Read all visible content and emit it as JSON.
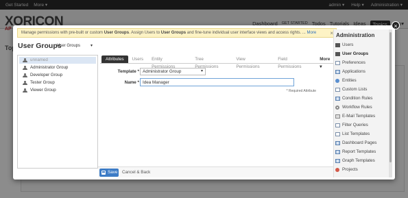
{
  "topbar": {
    "get_started": "Get Started",
    "more": "More ▾",
    "user": "admin ▾",
    "help": "Help ▾",
    "administration": "Administration ▾"
  },
  "app": {
    "logo": "XORICON",
    "logo_sub": "AP"
  },
  "mainnav": [
    "Dashboard",
    "GET STARTED",
    "Todos",
    "Tutorials",
    "Ideas",
    "Topics",
    "Mo▾"
  ],
  "background": {
    "title": "Top"
  },
  "notice": {
    "text_1": "Manage permissions with pre-built or custom ",
    "b1": "User Groups",
    "text_2": ". Assign Users to ",
    "b2": "User Groups",
    "text_3": " and fine-tune individual user interface views and access rights. ...",
    "more": "More",
    "close": "×"
  },
  "page": {
    "title": "User Groups",
    "group_select": "User Groups",
    "caret": "▾"
  },
  "groups": [
    {
      "label": "unnamed",
      "selected": true
    },
    {
      "label": "Administrator Group",
      "selected": false
    },
    {
      "label": "Developer Group",
      "selected": false
    },
    {
      "label": "Tester Group",
      "selected": false
    },
    {
      "label": "Viewer Group",
      "selected": false
    }
  ],
  "tabs": [
    "Attributes",
    "Users",
    "Entity Permissions",
    "Tree Permissions",
    "View Permissions",
    "Field Permissions",
    "More ▾"
  ],
  "form": {
    "template_label": "Template *",
    "template_value": "Administrator Group",
    "name_label": "Name *",
    "name_value": "Idea Manager",
    "required_note": "* Required Attribute"
  },
  "footer": {
    "save": "Save",
    "cancel": "Cancel & Back"
  },
  "admin_menu": {
    "title": "Administration",
    "items": [
      {
        "label": "Users",
        "icon": "users-icon"
      },
      {
        "label": "User Groups",
        "icon": "user-groups-icon",
        "active": true
      },
      {
        "label": "Preferences",
        "icon": "preferences-icon"
      },
      {
        "label": "Applications",
        "icon": "applications-icon"
      },
      {
        "label": "Entities",
        "icon": "entities-icon"
      },
      {
        "label": "Custom Lists",
        "icon": "custom-lists-icon"
      },
      {
        "label": "Condition Rules",
        "icon": "condition-rules-icon"
      },
      {
        "label": "Workflow Rules",
        "icon": "workflow-rules-icon"
      },
      {
        "label": "E-Mail Templates",
        "icon": "email-templates-icon"
      },
      {
        "label": "Filter Queries",
        "icon": "filter-queries-icon"
      },
      {
        "label": "List Templates",
        "icon": "list-templates-icon"
      },
      {
        "label": "Dashboard Pages",
        "icon": "dashboard-pages-icon"
      },
      {
        "label": "Report Templates",
        "icon": "report-templates-icon"
      },
      {
        "label": "Graph Templates",
        "icon": "graph-templates-icon"
      },
      {
        "label": "Projects",
        "icon": "projects-icon"
      }
    ]
  },
  "modal": {
    "close": "×"
  }
}
